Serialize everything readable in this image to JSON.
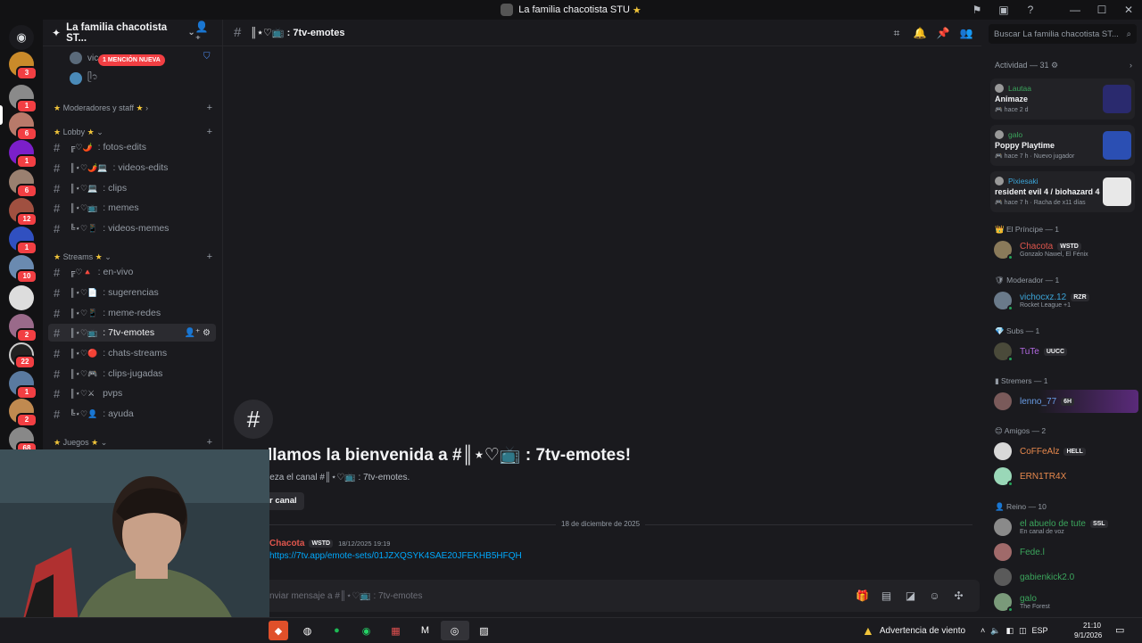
{
  "window": {
    "title": "La familia chacotista STU",
    "title_star": "★"
  },
  "servers": {
    "badges": [
      "3",
      "1",
      "6",
      "1",
      "6",
      "12",
      "1",
      "10",
      "2",
      "22",
      "1",
      "2",
      "68"
    ]
  },
  "guild": {
    "name": "La familia chacotista ST...",
    "voice_users": [
      "vic",
      "ᥫ᭡"
    ],
    "mention_pill": "1 MENCIÓN NUEVA"
  },
  "categories": [
    {
      "label": "Moderadores y staff"
    },
    {
      "label": "Lobby"
    },
    {
      "label": "Streams"
    },
    {
      "label": "Juegos"
    }
  ],
  "channels": [
    {
      "deco": "╔♡🌶️",
      "name": "fotos-edits"
    },
    {
      "deco": "║⋆♡🌶️💻",
      "name": "videos-edits"
    },
    {
      "deco": "║⋆♡💻",
      "name": "clips"
    },
    {
      "deco": "║⋆♡📺",
      "name": "memes"
    },
    {
      "deco": "╚⋆♡📱",
      "name": "videos-memes"
    },
    {
      "deco": "╔♡🔺",
      "name": "en-vivo"
    },
    {
      "deco": "║⋆♡📄",
      "name": "sugerencias"
    },
    {
      "deco": "║⋆♡📱",
      "name": "meme-redes"
    },
    {
      "deco": "║⋆♡📺",
      "name": "7tv-emotes"
    },
    {
      "deco": "║⋆♡🔴",
      "name": "chats-streams"
    },
    {
      "deco": "║⋆♡🎮",
      "name": "clips-jugadas"
    },
    {
      "deco": "║⋆♡⚔",
      "name": "pvps"
    },
    {
      "deco": "╚⋆♡👤",
      "name": "ayuda"
    }
  ],
  "header": {
    "channel": "║⋆♡📺 : 7tv-emotes",
    "search_placeholder": "Buscar La familia chacotista ST..."
  },
  "welcome": {
    "title": "llamos la bienvenida a #║⋆♡📺 : 7tv-emotes!",
    "subtitle": "ieza el canal #║⋆♡📺 : 7tv-emotes.",
    "edit_button": "r canal"
  },
  "date_divider": "18 de diciembre de 2025",
  "message": {
    "author": "Chacota",
    "tag": "WSTD",
    "time": "18/12/2025 19:19",
    "link": "https://7tv.app/emote-sets/01JZXQSYK4SAE20JFEKHB5HFQH"
  },
  "composer": {
    "placeholder": "nviar mensaje a #║⋆♡📺 : 7tv-emotes"
  },
  "activity": {
    "header": "Actividad — 31",
    "cards": [
      {
        "user": "Lautaa",
        "game": "Animaze",
        "time": "hace 2 d",
        "thumb_color": "#2a2a6e"
      },
      {
        "user": "galo",
        "game": "Poppy Playtime",
        "time": "hace 7 h  ·  Nuevo jugador",
        "thumb_color": "#2b4fb3"
      },
      {
        "user": "Pixiesaki",
        "game": "resident evil 4 / biohazard 4",
        "time": "hace 7 h  ·  Racha de x11 días",
        "thumb_color": "#e8e8e8"
      }
    ]
  },
  "roles": [
    {
      "label": "El Príncipe — 1",
      "members": [
        {
          "name": "Chacota",
          "tag": "WSTD",
          "status": "Gonzalo Nawel, El Fénix",
          "color": "#e0564d"
        }
      ]
    },
    {
      "label": "Moderador — 1",
      "members": [
        {
          "name": "vichocxz.12",
          "tag": "RZR",
          "status": "Rocket League +1",
          "color": "#3ba5d9"
        }
      ]
    },
    {
      "label": "Subs — 1",
      "members": [
        {
          "name": "TuTe",
          "tag": "UUCC",
          "status": "",
          "color": "#b36ae2"
        }
      ]
    },
    {
      "label": "Stremers — 1",
      "members": [
        {
          "name": "lenno_77",
          "tag": "6H",
          "status": "",
          "color": "#6a9ee8"
        }
      ]
    },
    {
      "label": "Amigos — 2",
      "members": [
        {
          "name": "CoFFeAlz",
          "tag": "HELL",
          "status": "",
          "color": "#e8894d"
        },
        {
          "name": "ERN1TR4X",
          "tag": "",
          "status": "",
          "color": "#e8894d"
        }
      ]
    },
    {
      "label": "Reino — 10",
      "members": [
        {
          "name": "el abuelo de tute",
          "tag": "SSL",
          "status": "En canal de voz",
          "color": "#3ba55c"
        },
        {
          "name": "Fede.l",
          "tag": "",
          "status": "",
          "color": "#3ba55c"
        },
        {
          "name": "gabienkick2.0",
          "tag": "",
          "status": "",
          "color": "#3ba55c"
        },
        {
          "name": "galo",
          "tag": "",
          "status": "The Forest",
          "color": "#3ba55c"
        }
      ]
    }
  ],
  "taskbar": {
    "weather": "Advertencia de viento",
    "lang": "ESP",
    "time": "21:10",
    "date": "9/1/2026"
  }
}
